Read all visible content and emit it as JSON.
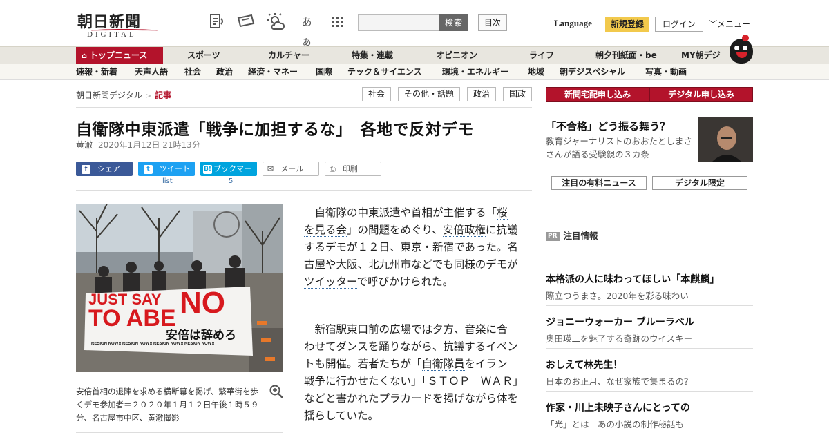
{
  "header": {
    "logo_main": "朝日新聞",
    "logo_sub": "DIGITAL",
    "icons": [
      "newspaper-audio-icon",
      "ticket-icon",
      "weather-icon",
      "font-size-icon",
      "grid-icon"
    ],
    "font_size_glyph": "あぁ",
    "search_placeholder": "",
    "search_label": "検索",
    "toc_label": "目次",
    "language_label": "Language",
    "signup_label": "新規登録",
    "login_label": "ログイン",
    "menu_label": "メニュー"
  },
  "nav_main": [
    {
      "label": "トップニュース"
    },
    {
      "label": "スポーツ"
    },
    {
      "label": "カルチャー"
    },
    {
      "label": "特集・連載"
    },
    {
      "label": "オピニオン"
    },
    {
      "label": "ライフ"
    },
    {
      "label": "朝夕刊紙面・be"
    },
    {
      "label": "MY朝デジ"
    }
  ],
  "nav_sub": [
    {
      "label": "速報・新着"
    },
    {
      "label": "天声人語"
    },
    {
      "label": "社会"
    },
    {
      "label": "政治"
    },
    {
      "label": "経済・マネー"
    },
    {
      "label": "国際"
    },
    {
      "label": "テック＆サイエンス"
    },
    {
      "label": "環境・エネルギー"
    },
    {
      "label": "地域"
    },
    {
      "label": "朝デジスペシャル"
    },
    {
      "label": "写真・動画"
    }
  ],
  "breadcrumb": {
    "home": "朝日新聞デジタル",
    "sep": ">",
    "current": "記事"
  },
  "tags": [
    "社会",
    "その他・話題",
    "政治",
    "国政"
  ],
  "article": {
    "title": "自衛隊中東派遣「戦争に加担するな」　各地で反対デモ",
    "author": "黄澈",
    "date": "2020年1月12日 21時13分",
    "share": {
      "facebook": "シェア",
      "twitter": "ツイート",
      "twitter_count": "list",
      "hatena": "ブックマーク",
      "hatena_count": "5",
      "mail": "メール",
      "print": "印刷"
    },
    "photo": {
      "banner_line1": "JUST SAY",
      "banner_no": "NO",
      "banner_line2": "TO ABE",
      "banner_jp": "安倍は辞めろ",
      "banner_resign": "RESIGN NOW!! RESIGN NOW!! RESIGN NOW!! RESIGN NOW!!"
    },
    "caption": "安倍首相の退陣を求める横断幕を掲げ、繁華街を歩くデモ参加者＝２０２０年１月１２日午後１時５９分、名古屋市中区、黄澈撮影",
    "p1": {
      "a": "自衛隊の中東派遣や首相が主催する「",
      "link1": "桜を見る会",
      "b": "」の問題をめぐり、",
      "link2": "安倍政権",
      "c": "に抗議するデモが１２日、東京・新宿であった。名古屋や大阪、",
      "link3": "北九州",
      "d": "市などでも同様のデモが",
      "link4": "ツイッター",
      "e": "で呼びかけられた。"
    },
    "p2": {
      "link1": "新宿駅",
      "a": "東口前の広場では夕方、音楽に合わせてダンスを踊りながら、抗議するイベントも開催。若者たちが「",
      "link2": "自衛隊員",
      "b": "をイラン戦争に行かせたくない」「ＳＴＯＰ　ＷＡＲ」などと書かれたプラカードを掲げながら体を揺らしていた。"
    }
  },
  "sidebar": {
    "btn_paper": "新聞宅配申し込み",
    "btn_digital": "デジタル申し込み",
    "feature_title": "「不合格」どう振る舞う？",
    "feature_desc": "教育ジャーナリストのおおたとしまささんが語る受験親の３カ条",
    "tab_paid": "注目の有料ニュース",
    "tab_digital": "デジタル限定",
    "pr_badge": "PR",
    "pr_heading": "注目情報",
    "pr_items": [
      {
        "title": "本格派の人に味わってほしい「本麒麟」",
        "desc": "際立つうまさ。2020年を彩る味わい"
      },
      {
        "title": "ジョニーウォーカー ブルーラベル",
        "desc": "奥田瑛二を魅了する奇跡のウイスキー"
      },
      {
        "title": "おしえて林先生！",
        "desc": "日本のお正月、なぜ家族で集まるの？"
      },
      {
        "title": "作家・川上未映子さんにとっての",
        "desc": "「光」とは　あの小説の制作秘話も"
      }
    ]
  }
}
